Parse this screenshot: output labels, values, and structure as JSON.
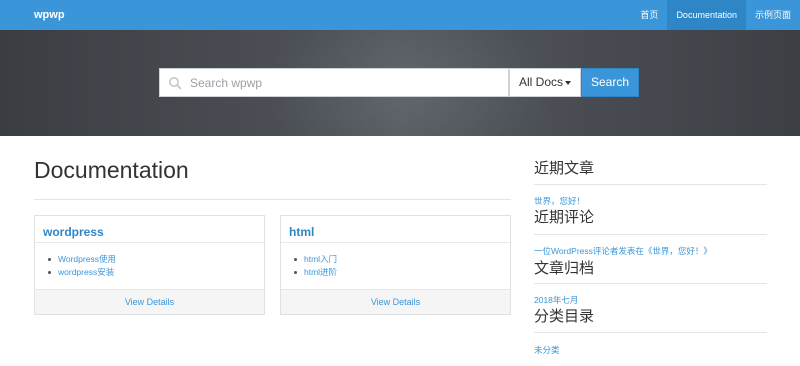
{
  "nav": {
    "brand": "wpwp",
    "links": [
      {
        "label": "首页",
        "active": false
      },
      {
        "label": "Documentation",
        "active": true
      },
      {
        "label": "示例页面",
        "active": false
      }
    ]
  },
  "search": {
    "placeholder": "Search wpwp",
    "scope_label": "All Docs",
    "button_label": "Search"
  },
  "main": {
    "title": "Documentation",
    "cards": [
      {
        "title": "wordpress",
        "items": [
          "Wordpress使用",
          "wordpress安装"
        ],
        "footer": "View Details"
      },
      {
        "title": "html",
        "items": [
          "html入门",
          "html进阶"
        ],
        "footer": "View Details"
      }
    ]
  },
  "sidebar": {
    "recent_posts": {
      "heading": "近期文章",
      "items": [
        "世界，您好！"
      ]
    },
    "recent_comments": {
      "heading": "近期评论",
      "items": [
        "一位WordPress评论者发表在《世界，您好！》"
      ]
    },
    "archives": {
      "heading": "文章归档",
      "items": [
        "2018年七月"
      ]
    },
    "categories": {
      "heading": "分类目录",
      "items": [
        "未分类"
      ]
    }
  },
  "colors": {
    "accent": "#3a96d9",
    "accent_dark": "#2f86c6",
    "hero_bg": "#484c52"
  }
}
